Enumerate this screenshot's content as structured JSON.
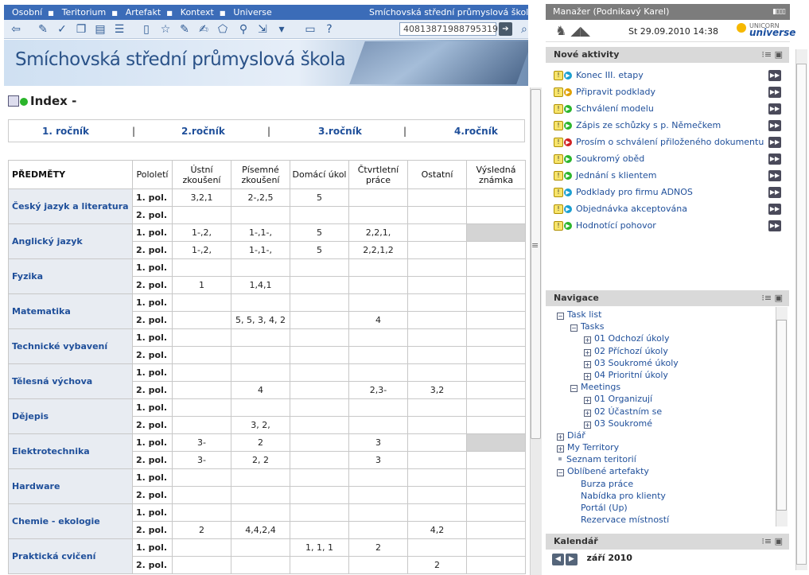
{
  "menu": {
    "items": [
      "Osobní",
      "Teritorium",
      "Artefakt",
      "Kontext",
      "Universe"
    ],
    "title": "Smíchovská střední průmyslová škola"
  },
  "toolbar": {
    "search_value": "40813871988795319"
  },
  "banner": {
    "title": "Smíchovská střední průmyslová škola"
  },
  "page": {
    "title": "Index -"
  },
  "tabs": [
    "1. ročník",
    "2.ročník",
    "3.ročník",
    "4.ročník"
  ],
  "table": {
    "headers": [
      "PŘEDMĚTY",
      "Pololetí",
      "Ústní zkoušení",
      "Písemné zkoušení",
      "Domácí úkol",
      "Čtvrtletní práce",
      "Ostatní",
      "Výsledná známka"
    ],
    "subjects": [
      {
        "name": "Český jazyk a literatura",
        "rows": [
          [
            "1. pol.",
            "3,2,1",
            "2-,2,5",
            "5",
            "",
            ""
          ],
          [
            "2. pol.",
            "",
            "",
            "",
            "",
            ""
          ]
        ],
        "grey": false
      },
      {
        "name": "Anglický jazyk",
        "rows": [
          [
            "1. pol.",
            "1-,2,",
            "1-,1-,",
            "5",
            "2,2,1,",
            ""
          ],
          [
            "2. pol.",
            "1-,2,",
            "1-,1-,",
            "5",
            "2,2,1,2",
            ""
          ]
        ],
        "grey": true
      },
      {
        "name": "Fyzika",
        "rows": [
          [
            "1. pol.",
            "",
            "",
            "",
            "",
            ""
          ],
          [
            "2. pol.",
            "1",
            "1,4,1",
            "",
            "",
            ""
          ]
        ],
        "grey": false
      },
      {
        "name": "Matematika",
        "rows": [
          [
            "1. pol.",
            "",
            "",
            "",
            "",
            ""
          ],
          [
            "2. pol.",
            "",
            "5, 5, 3, 4, 2",
            "",
            "4",
            ""
          ]
        ],
        "grey": false
      },
      {
        "name": "Technické vybavení",
        "rows": [
          [
            "1. pol.",
            "",
            "",
            "",
            "",
            ""
          ],
          [
            "2. pol.",
            "",
            "",
            "",
            "",
            ""
          ]
        ],
        "grey": false
      },
      {
        "name": "Tělesná výchova",
        "rows": [
          [
            "1. pol.",
            "",
            "",
            "",
            "",
            ""
          ],
          [
            "2. pol.",
            "",
            "4",
            "",
            "2,3-",
            "3,2"
          ]
        ],
        "grey": false
      },
      {
        "name": "Dějepis",
        "rows": [
          [
            "1. pol.",
            "",
            "",
            "",
            "",
            ""
          ],
          [
            "2. pol.",
            "",
            "3, 2,",
            "",
            "",
            ""
          ]
        ],
        "grey": false
      },
      {
        "name": "Elektrotechnika",
        "rows": [
          [
            "1. pol.",
            "3-",
            "2",
            "",
            "3",
            ""
          ],
          [
            "2. pol.",
            "3-",
            "2, 2",
            "",
            "3",
            ""
          ]
        ],
        "grey": true
      },
      {
        "name": "Hardware",
        "rows": [
          [
            "1. pol.",
            "",
            "",
            "",
            "",
            ""
          ],
          [
            "2. pol.",
            "",
            "",
            "",
            "",
            ""
          ]
        ],
        "grey": false
      },
      {
        "name": "Chemie - ekologie",
        "rows": [
          [
            "1. pol.",
            "",
            "",
            "",
            "",
            ""
          ],
          [
            "2. pol.",
            "2",
            "4,4,2,4",
            "",
            "",
            "4,2"
          ]
        ],
        "grey": false
      },
      {
        "name": "Praktická cvičení",
        "rows": [
          [
            "1. pol.",
            "",
            "",
            "1, 1, 1",
            "2",
            ""
          ],
          [
            "2. pol.",
            "",
            "",
            "",
            "",
            "2"
          ]
        ],
        "grey": false
      }
    ]
  },
  "right": {
    "user": "Manažer (Podnikavý Karel)",
    "date": "St 29.09.2010 14:38",
    "brand_small": "UNICORN",
    "brand": "universe",
    "aktivity_title": "Nové aktivity",
    "aktivity": [
      {
        "label": "Konec III. etapy",
        "color": "#1a9fd0"
      },
      {
        "label": "Připravit podklady",
        "color": "#e0a000"
      },
      {
        "label": "Schválení modelu",
        "color": "#2bb52b"
      },
      {
        "label": "Zápis ze schůzky s p. Němečkem",
        "color": "#2bb52b"
      },
      {
        "label": "Prosím o schválení přiloženého dokumentu",
        "color": "#d02020"
      },
      {
        "label": "Soukromý oběd",
        "color": "#2bb52b"
      },
      {
        "label": "Jednání s klientem",
        "color": "#2bb52b"
      },
      {
        "label": "Podklady pro firmu ADNOS",
        "color": "#1a9fd0"
      },
      {
        "label": "Objednávka akceptována",
        "color": "#1a9fd0"
      },
      {
        "label": "Hodnotící pohovor",
        "color": "#2bb52b"
      }
    ],
    "navigace_title": "Navigace",
    "navigace": [
      {
        "label": "Task list",
        "indent": 0,
        "kind": "minus"
      },
      {
        "label": "Tasks",
        "indent": 1,
        "kind": "minus"
      },
      {
        "label": "01 Odchozí úkoly",
        "indent": 2,
        "kind": "plus"
      },
      {
        "label": "02 Příchozí úkoly",
        "indent": 2,
        "kind": "plus"
      },
      {
        "label": "03 Soukromé úkoly",
        "indent": 2,
        "kind": "plus"
      },
      {
        "label": "04 Prioritní úkoly",
        "indent": 2,
        "kind": "plus"
      },
      {
        "label": "Meetings",
        "indent": 1,
        "kind": "minus"
      },
      {
        "label": "01 Organizují",
        "indent": 2,
        "kind": "plus"
      },
      {
        "label": "02 Účastním se",
        "indent": 2,
        "kind": "plus"
      },
      {
        "label": "03 Soukromé",
        "indent": 2,
        "kind": "plus"
      },
      {
        "label": "Diář",
        "indent": 0,
        "kind": "plus"
      },
      {
        "label": "My Territory",
        "indent": 0,
        "kind": "plus"
      },
      {
        "label": "Seznam teritorií",
        "indent": 0,
        "kind": "bullet"
      },
      {
        "label": "Oblíbené artefakty",
        "indent": 0,
        "kind": "minus"
      },
      {
        "label": "Burza práce",
        "indent": 1,
        "kind": "none"
      },
      {
        "label": "Nabídka pro klienty",
        "indent": 1,
        "kind": "none"
      },
      {
        "label": "Portál (Up)",
        "indent": 1,
        "kind": "none"
      },
      {
        "label": "Rezervace místností",
        "indent": 1,
        "kind": "none"
      }
    ],
    "kalendar_title": "Kalendář",
    "kalendar_month": "září 2010"
  }
}
